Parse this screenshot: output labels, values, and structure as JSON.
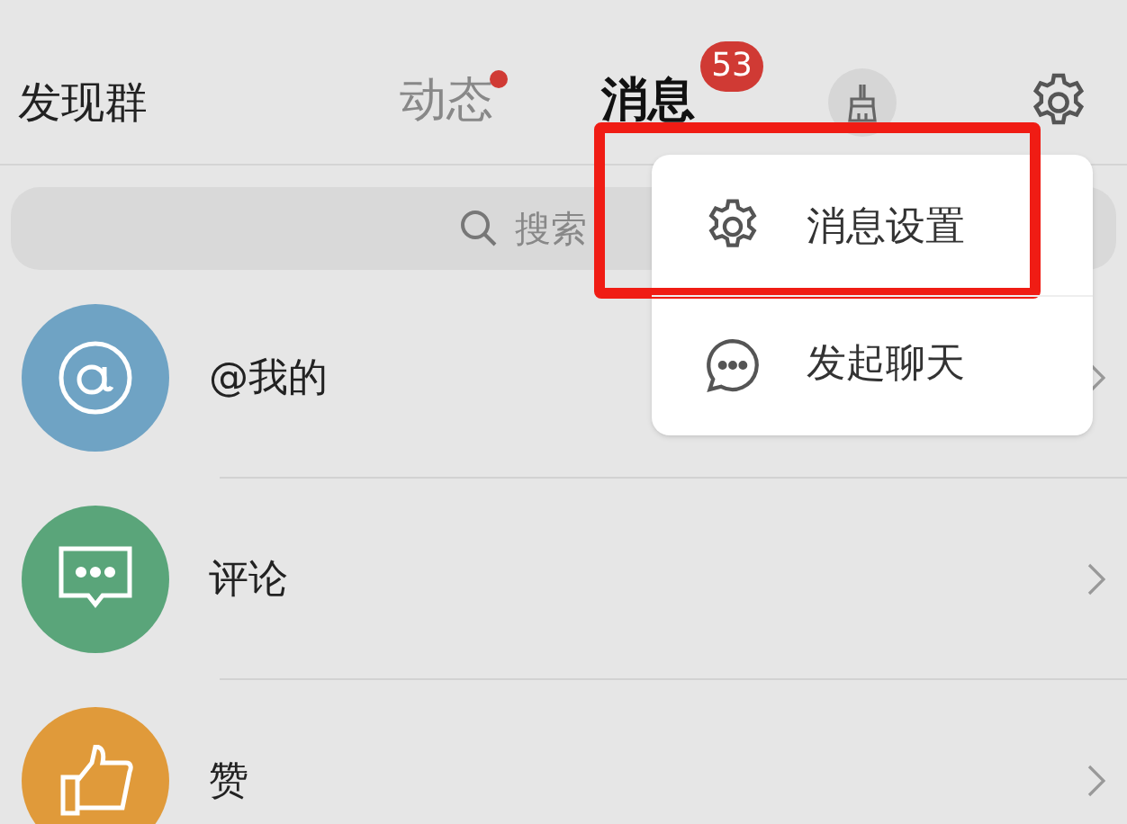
{
  "header": {
    "title": "发现群",
    "tabs": [
      {
        "label": "动态",
        "selected": false,
        "dot": true
      },
      {
        "label": "消息",
        "selected": true,
        "badge": "53"
      }
    ]
  },
  "search": {
    "placeholder": "搜索"
  },
  "rows": [
    {
      "kind": "mention",
      "label": "@我的",
      "color": "#6fa3c4"
    },
    {
      "kind": "comment",
      "label": "评论",
      "color": "#5aa57a"
    },
    {
      "kind": "like",
      "label": "赞",
      "color": "#e09a3a"
    }
  ],
  "menu": {
    "items": [
      {
        "kind": "settings",
        "label": "消息设置",
        "highlighted": true
      },
      {
        "kind": "chat",
        "label": "发起聊天",
        "highlighted": false
      }
    ]
  }
}
